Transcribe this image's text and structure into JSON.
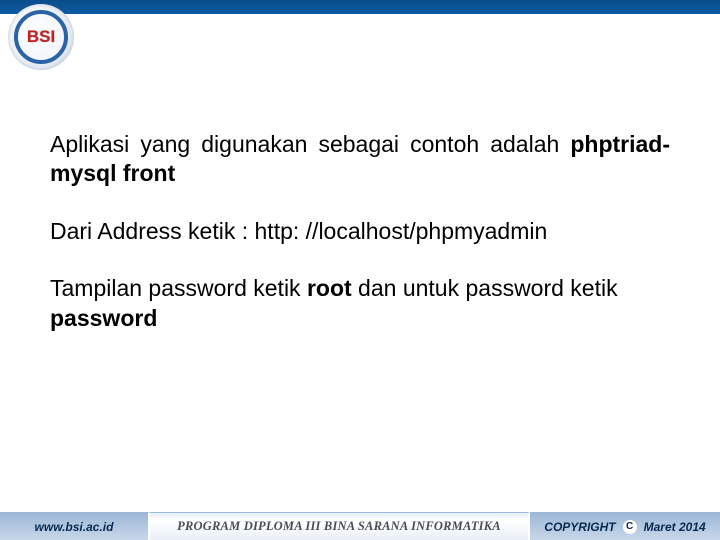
{
  "logo_text": "BSI",
  "paragraphs": {
    "intro_prefix": "Aplikasi yang digunakan sebagai contoh adalah ",
    "intro_bold": "phptriad-mysql front",
    "address": "Dari Address ketik : http: //localhost/phpmyadmin",
    "pw_1": "Tampilan password ketik  ",
    "pw_bold1": "root",
    "pw_2": " dan untuk password ketik ",
    "pw_bold2": "password"
  },
  "footer": {
    "url": "www.bsi.ac.id",
    "program": "PROGRAM DIPLOMA III BINA SARANA INFORMATIKA",
    "copyright_label": "COPYRIGHT",
    "copyright_symbol": "C",
    "copyright_date": "Maret 2014"
  }
}
